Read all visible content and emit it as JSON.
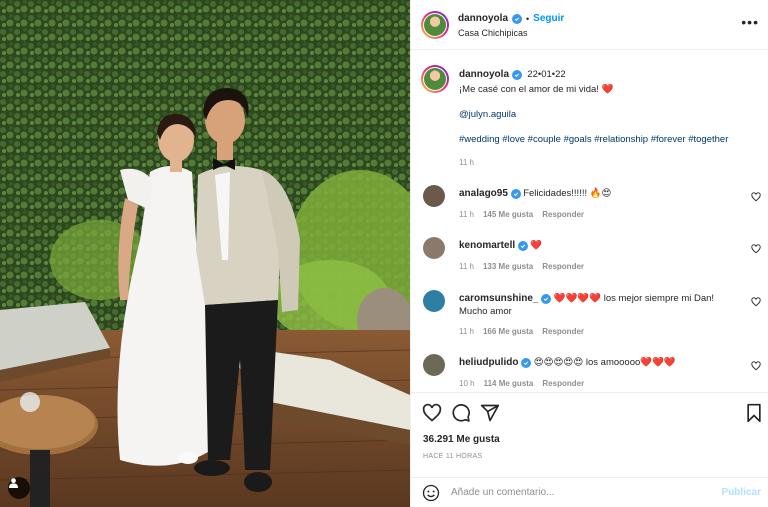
{
  "post": {
    "author": "dannoyola",
    "follow_label": "Seguir",
    "location": "Casa Chichipicas",
    "caption": {
      "date": "22•01•22",
      "line1": "¡Me casé con el amor de mi vida!",
      "line1_emoji": "❤️",
      "mention": "@julyn.aguila",
      "hashtags": "#wedding #love #couple #goals #relationship #forever #together",
      "age": "11 h"
    },
    "likes": "36.291 Me gusta",
    "posted_ago": "HACE 11 HORAS"
  },
  "comments": [
    {
      "user": "analago95",
      "text": "Felicidades!!!!!! 🔥😍",
      "age": "11 h",
      "likes": "145 Me gusta",
      "reply": "Responder",
      "avatar_color": "#6b5a4a"
    },
    {
      "user": "kenomartell",
      "text": "❤️",
      "age": "11 h",
      "likes": "133 Me gusta",
      "reply": "Responder",
      "avatar_color": "#8a7a6c"
    },
    {
      "user": "caromsunshine_",
      "text": "❤️❤️❤️❤️ los mejor siempre mi Dan! Mucho amor",
      "age": "11 h",
      "likes": "166 Me gusta",
      "reply": "Responder",
      "avatar_color": "#2f7fa5"
    },
    {
      "user": "heliudpulido",
      "text": "😍😍😍😍😍 los amooooo❤️❤️❤️",
      "age": "10 h",
      "likes": "114 Me gusta",
      "reply": "Responder",
      "avatar_color": "#6c6a57"
    }
  ],
  "composer": {
    "placeholder": "Añade un comentario...",
    "publish_label": "Publicar"
  },
  "icons": [
    "more-icon",
    "heart-icon",
    "comment-icon",
    "share-icon",
    "bookmark-icon",
    "emoji-icon",
    "verified-icon",
    "user-tag-icon"
  ],
  "colors": {
    "link": "#00376b",
    "accent": "#0095f6",
    "verified": "#3897f0",
    "publish_disabled": "#b2dffc",
    "muted": "#8e8e8e"
  }
}
